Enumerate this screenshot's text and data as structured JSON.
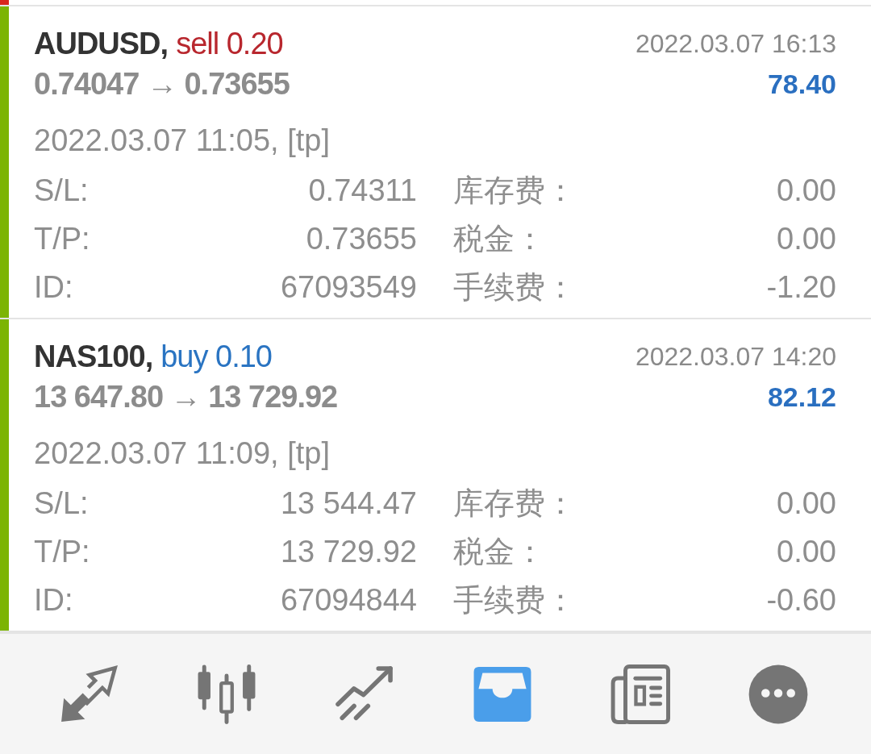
{
  "scrolled_item": {
    "color": "#d9261c"
  },
  "trades": [
    {
      "color": "#7cb404",
      "kind": "sell",
      "symbol": "AUDUSD,",
      "order": "sell 0.20",
      "close_time": "2022.03.07 16:13",
      "prices": "0.74047 → 0.73655",
      "profit": "78.40",
      "open_time": "2022.03.07 11:05, [tp]",
      "fields": [
        {
          "label": "S/L:",
          "value": "0.74311"
        },
        {
          "label": "库存费：",
          "value": "0.00"
        },
        {
          "label": "T/P:",
          "value": "0.73655"
        },
        {
          "label": "税金：",
          "value": "0.00"
        },
        {
          "label": "ID:",
          "value": "67093549"
        },
        {
          "label": "手续费：",
          "value": "-1.20"
        }
      ]
    },
    {
      "color": "#7cb404",
      "kind": "buy",
      "symbol": "NAS100,",
      "order": "buy 0.10",
      "close_time": "2022.03.07 14:20",
      "prices": "13 647.80 → 13 729.92",
      "profit": "82.12",
      "open_time": "2022.03.07 11:09, [tp]",
      "fields": [
        {
          "label": "S/L:",
          "value": "13 544.47"
        },
        {
          "label": "库存费：",
          "value": "0.00"
        },
        {
          "label": "T/P:",
          "value": "13 729.92"
        },
        {
          "label": "税金：",
          "value": "0.00"
        },
        {
          "label": "ID:",
          "value": "67094844"
        },
        {
          "label": "手续费：",
          "value": "-0.60"
        }
      ]
    }
  ],
  "bottom_nav": [
    {
      "selected": false
    },
    {
      "selected": false
    },
    {
      "selected": false
    },
    {
      "selected": true
    },
    {
      "selected": false
    },
    {
      "selected": false
    }
  ]
}
